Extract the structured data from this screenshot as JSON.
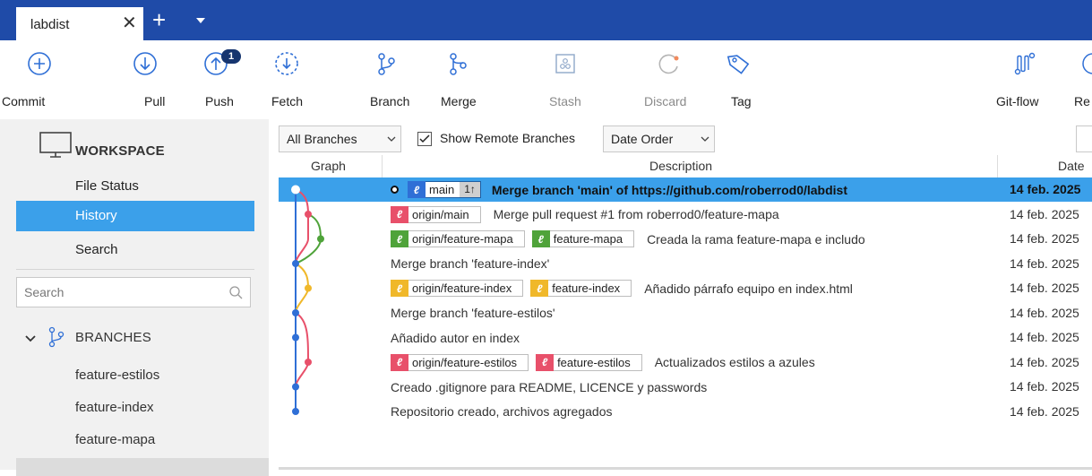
{
  "tab": {
    "title": "labdist"
  },
  "toolbar": {
    "commit": "Commit",
    "pull": "Pull",
    "push": "Push",
    "push_badge": "1",
    "fetch": "Fetch",
    "branch": "Branch",
    "merge": "Merge",
    "stash": "Stash",
    "discard": "Discard",
    "tag": "Tag",
    "gitflow": "Git-flow",
    "remote_partial": "Re"
  },
  "sidebar": {
    "workspace": "WORKSPACE",
    "items": [
      "File Status",
      "History",
      "Search"
    ],
    "active_item": "History",
    "search_placeholder": "Search",
    "branches_header": "BRANCHES",
    "branches": [
      "feature-estilos",
      "feature-index",
      "feature-mapa"
    ]
  },
  "filters": {
    "branches": "All Branches",
    "show_remote": "Show Remote Branches",
    "show_remote_checked": true,
    "order": "Date Order"
  },
  "columns": {
    "graph": "Graph",
    "description": "Description",
    "date": "Date"
  },
  "commits": [
    {
      "tags": [
        {
          "name": "main",
          "color": "#2f6fd6",
          "ahead": "1↑"
        }
      ],
      "message": "Merge branch 'main' of https://github.com/roberrod0/labdist",
      "date": "14 feb. 2025",
      "selected": true
    },
    {
      "tags": [
        {
          "name": "origin/main",
          "color": "#e8506a"
        }
      ],
      "message": "Merge pull request #1 from roberrod0/feature-mapa",
      "date": "14 feb. 2025"
    },
    {
      "tags": [
        {
          "name": "origin/feature-mapa",
          "color": "#4fa33a"
        },
        {
          "name": "feature-mapa",
          "color": "#4fa33a"
        }
      ],
      "message": "Creada la rama feature-mapa e includo",
      "date": "14 feb. 2025"
    },
    {
      "tags": [],
      "message": "Merge branch 'feature-index'",
      "date": "14 feb. 2025"
    },
    {
      "tags": [
        {
          "name": "origin/feature-index",
          "color": "#f0b82a"
        },
        {
          "name": "feature-index",
          "color": "#f0b82a"
        }
      ],
      "message": "Añadido párrafo equipo en index.html",
      "date": "14 feb. 2025"
    },
    {
      "tags": [],
      "message": "Merge branch 'feature-estilos'",
      "date": "14 feb. 2025"
    },
    {
      "tags": [],
      "message": "Añadido autor en index",
      "date": "14 feb. 2025"
    },
    {
      "tags": [
        {
          "name": "origin/feature-estilos",
          "color": "#e8506a"
        },
        {
          "name": "feature-estilos",
          "color": "#e8506a"
        }
      ],
      "message": "Actualizados estilos a azules",
      "date": "14 feb. 2025"
    },
    {
      "tags": [],
      "message": "Creado .gitignore para README, LICENCE y passwords",
      "date": "14 feb. 2025"
    },
    {
      "tags": [],
      "message": "Repositorio creado, archivos agregados",
      "date": "14 feb. 2025"
    }
  ],
  "colors": {
    "titlebar": "#1f4ba8",
    "selection": "#3ba0ea",
    "lane_blue": "#2f6fd6",
    "lane_pink": "#e8506a",
    "lane_green": "#4fa33a",
    "lane_yellow": "#f0b82a"
  }
}
